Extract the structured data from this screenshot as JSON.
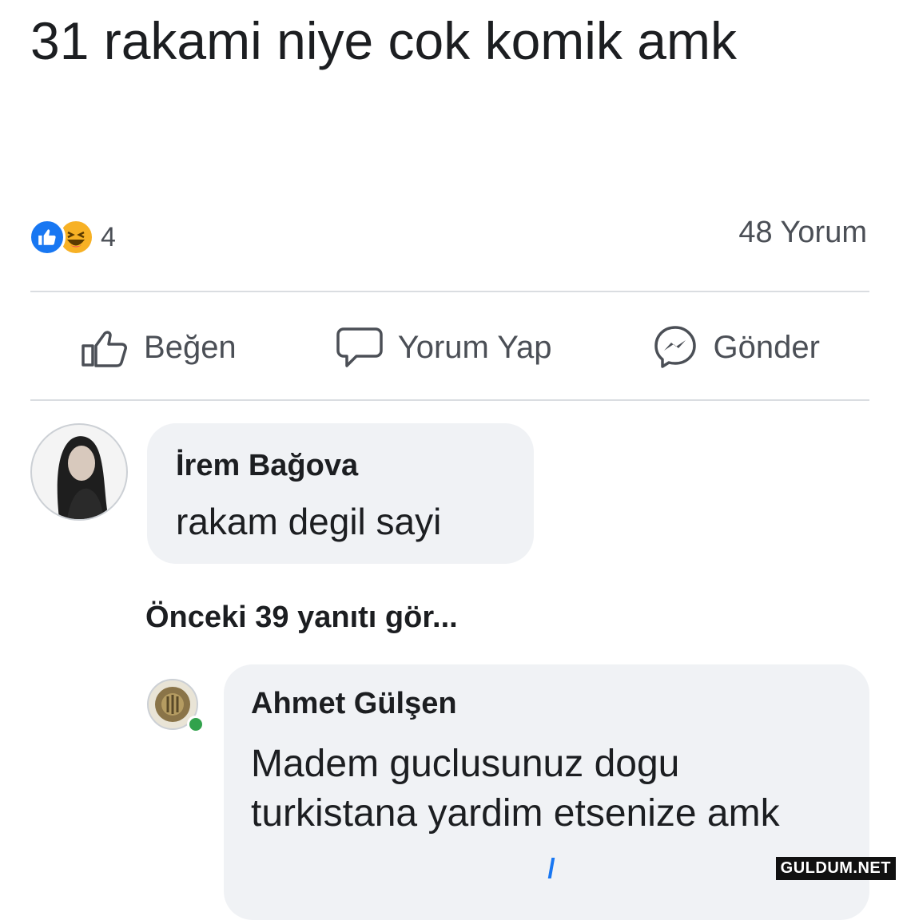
{
  "post": {
    "text": "31 rakami niye cok komik amk"
  },
  "stats": {
    "reaction_icons": [
      "like-icon",
      "haha-icon"
    ],
    "reaction_count": "4",
    "comment_count": "48 Yorum"
  },
  "actions": {
    "like_label": "Beğen",
    "comment_label": "Yorum Yap",
    "send_label": "Gönder"
  },
  "comments": [
    {
      "author": "İrem Bağova",
      "text": "rakam degil sayi"
    }
  ],
  "more_replies_label": "Önceki 39 yanıtı gör...",
  "replies": [
    {
      "author": "Ahmet Gülşen",
      "text": "Madem guclusunuz dogu turkistana yardim etsenize amk"
    }
  ],
  "watermark": "GULDUM.NET",
  "colors": {
    "like_blue": "#1877f2",
    "haha_yellow": "#f7b125",
    "bubble_bg": "#f0f2f5",
    "online_green": "#31a24c"
  }
}
